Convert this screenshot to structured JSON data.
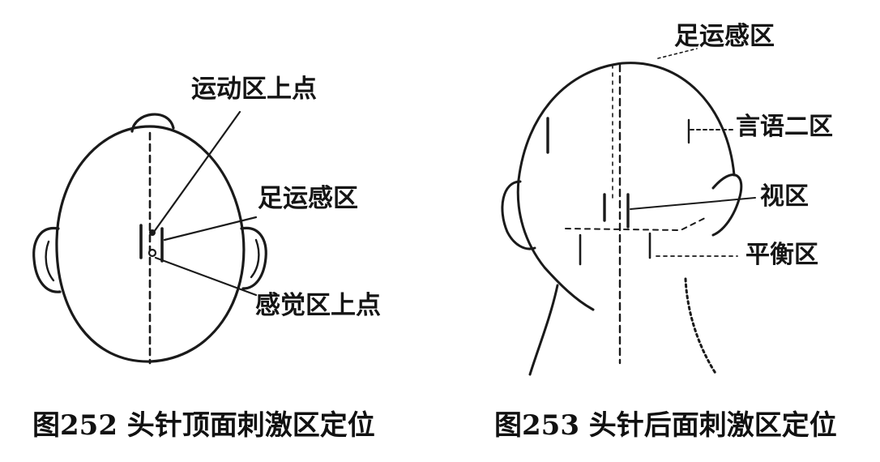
{
  "figure_left": {
    "labels": {
      "motor_upper_point": "运动区上点",
      "foot_motor_sensory": "足运感区",
      "sensory_upper_point": "感觉区上点"
    },
    "caption": "图252 头针顶面刺激区定位"
  },
  "figure_right": {
    "labels": {
      "foot_motor_sensory": "足运感区",
      "speech_two": "言语二区",
      "vision": "视区",
      "balance": "平衡区"
    },
    "caption": "图253 头针后面刺激区定位"
  }
}
